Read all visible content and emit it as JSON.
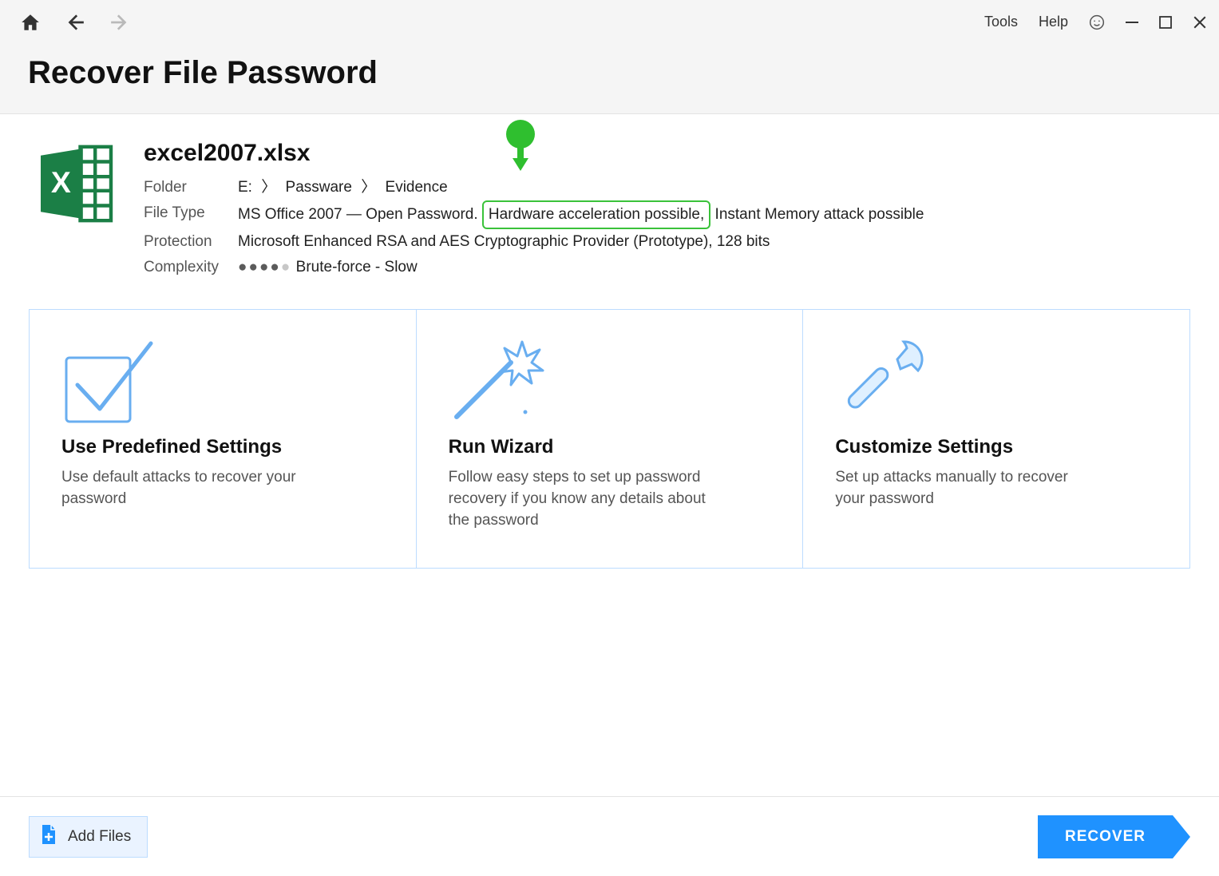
{
  "menu": {
    "tools": "Tools",
    "help": "Help"
  },
  "header": {
    "title": "Recover File Password"
  },
  "file": {
    "name": "excel2007.xlsx",
    "labels": {
      "folder": "Folder",
      "filetype": "File Type",
      "protection": "Protection",
      "complexity": "Complexity"
    },
    "folder_segments": [
      "E:",
      "Passware",
      "Evidence"
    ],
    "folder_sep": "〉",
    "filetype_prefix": "MS Office 2007 — Open Password. ",
    "filetype_highlight": "Hardware acceleration possible,",
    "filetype_suffix": " Instant Memory attack possible",
    "protection": "Microsoft Enhanced RSA and AES Cryptographic Provider (Prototype), 128 bits",
    "complexity_text": "Brute-force - Slow"
  },
  "cards": {
    "predefined": {
      "title": "Use Predefined Settings",
      "desc": "Use default attacks to recover your password"
    },
    "wizard": {
      "title": "Run Wizard",
      "desc": "Follow easy steps to set up password recovery if you know any details about the password"
    },
    "custom": {
      "title": "Customize Settings",
      "desc": "Set up attacks manually to recover your password"
    }
  },
  "footer": {
    "add_files": "Add Files",
    "recover": "RECOVER"
  }
}
